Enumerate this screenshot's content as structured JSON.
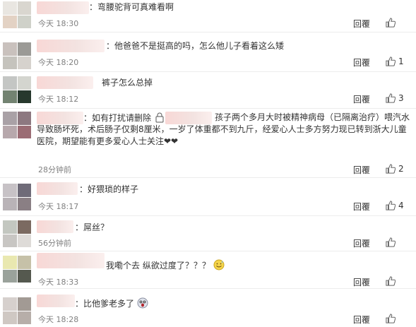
{
  "comments": [
    {
      "text": "：弯腰驼背可真难看啊",
      "time": "今天 18:30",
      "reply": "回覆",
      "likes": ""
    },
    {
      "text": "：他爸爸不是挺高的吗，怎么他儿子看着这么矮",
      "time": "今天 18:20",
      "reply": "回覆",
      "likes": "1"
    },
    {
      "text": "裤子怎么总掉",
      "time": "今天 18:12",
      "reply": "回覆",
      "likes": "3"
    },
    {
      "text_a": "：如有打扰请删除",
      "text_b": "孩子两个多月大时被精神病母（已隔离治疗）喂汽水导致肠坏死，术后肠子仅剩8厘米，一岁了体重都不到九斤，经爱心人士多方努力现已转到浙大儿童医院，期望能有更多爱心人士关注❤❤",
      "time": "28分钟前",
      "reply": "回覆",
      "likes": "2"
    },
    {
      "text": "：好猥琐的样子",
      "time": "今天 18:17",
      "reply": "回覆",
      "likes": "4"
    },
    {
      "text": "：屌丝？",
      "time": "56分钟前",
      "reply": "回覆",
      "likes": ""
    },
    {
      "text": "我嘞个去 纵欲过度了？？？",
      "time": "今天 18:33",
      "reply": "回覆",
      "likes": ""
    },
    {
      "text": "：比他爹老多了",
      "time": "今天 18:28",
      "reply": "回覆",
      "likes": ""
    }
  ],
  "colors": {
    "time": "#808080",
    "name_blur": "#f3e3e1",
    "border": "#ececec"
  },
  "icons": {
    "like": "thumbs-up-icon",
    "emoji_sweat": "sweat-smile-emoji-icon",
    "emoji_scared": "scared-emoji-icon",
    "lock": "lock-icon"
  }
}
